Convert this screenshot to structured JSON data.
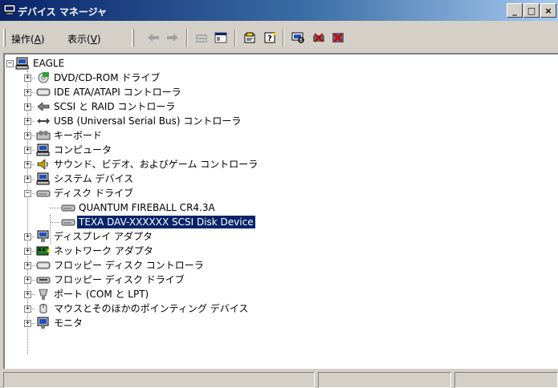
{
  "window": {
    "title": "デバイス マネージャ",
    "minimize": "_",
    "maximize": "□",
    "close": "×"
  },
  "menu": {
    "action": {
      "label": "操作",
      "accel": "A"
    },
    "view": {
      "label": "表示",
      "accel": "V"
    }
  },
  "toolbar_icons": [
    "back-arrow-icon",
    "forward-arrow-icon",
    "up-folder-icon",
    "show-hide-tree-icon",
    "properties-icon",
    "help-icon",
    "scan-hardware-icon",
    "uninstall-icon",
    "disable-icon"
  ],
  "tree": {
    "root": "EAGLE",
    "items": [
      {
        "label": "DVD/CD-ROM ドライブ",
        "icon": "cdrom-icon",
        "expanded": false
      },
      {
        "label": "IDE ATA/ATAPI コントローラ",
        "icon": "ide-controller-icon",
        "expanded": false
      },
      {
        "label": "SCSI と RAID コントローラ",
        "icon": "scsi-icon",
        "expanded": false
      },
      {
        "label": "USB (Universal Serial Bus) コントローラ",
        "icon": "usb-icon",
        "expanded": false
      },
      {
        "label": "キーボード",
        "icon": "keyboard-icon",
        "expanded": false
      },
      {
        "label": "コンピュータ",
        "icon": "computer-icon",
        "expanded": false
      },
      {
        "label": "サウンド、ビデオ、およびゲーム コントローラ",
        "icon": "sound-icon",
        "expanded": false
      },
      {
        "label": "システム デバイス",
        "icon": "system-device-icon",
        "expanded": false
      },
      {
        "label": "ディスク ドライブ",
        "icon": "disk-drive-icon",
        "expanded": true,
        "children": [
          {
            "label": "QUANTUM FIREBALL CR4.3A",
            "icon": "disk-drive-icon",
            "selected": false
          },
          {
            "label": "TEXA DAV-XXXXXX SCSI Disk Device",
            "icon": "disk-drive-icon",
            "selected": true
          }
        ]
      },
      {
        "label": "ディスプレイ アダプタ",
        "icon": "display-adapter-icon",
        "expanded": false
      },
      {
        "label": "ネットワーク アダプタ",
        "icon": "network-adapter-icon",
        "expanded": false
      },
      {
        "label": "フロッピー ディスク コントローラ",
        "icon": "floppy-controller-icon",
        "expanded": false
      },
      {
        "label": "フロッピー ディスク ドライブ",
        "icon": "floppy-drive-icon",
        "expanded": false
      },
      {
        "label": "ポート (COM と LPT)",
        "icon": "port-icon",
        "expanded": false
      },
      {
        "label": "マウスとそのほかのポインティング デバイス",
        "icon": "mouse-icon",
        "expanded": false
      },
      {
        "label": "モニタ",
        "icon": "monitor-icon",
        "expanded": false
      }
    ]
  },
  "statusbar": {
    "panels": [
      "",
      "",
      ""
    ]
  },
  "colors": {
    "title_start": "#0a246a",
    "title_end": "#a6caf0",
    "selection": "#0a246a",
    "face": "#d4d0c8"
  }
}
